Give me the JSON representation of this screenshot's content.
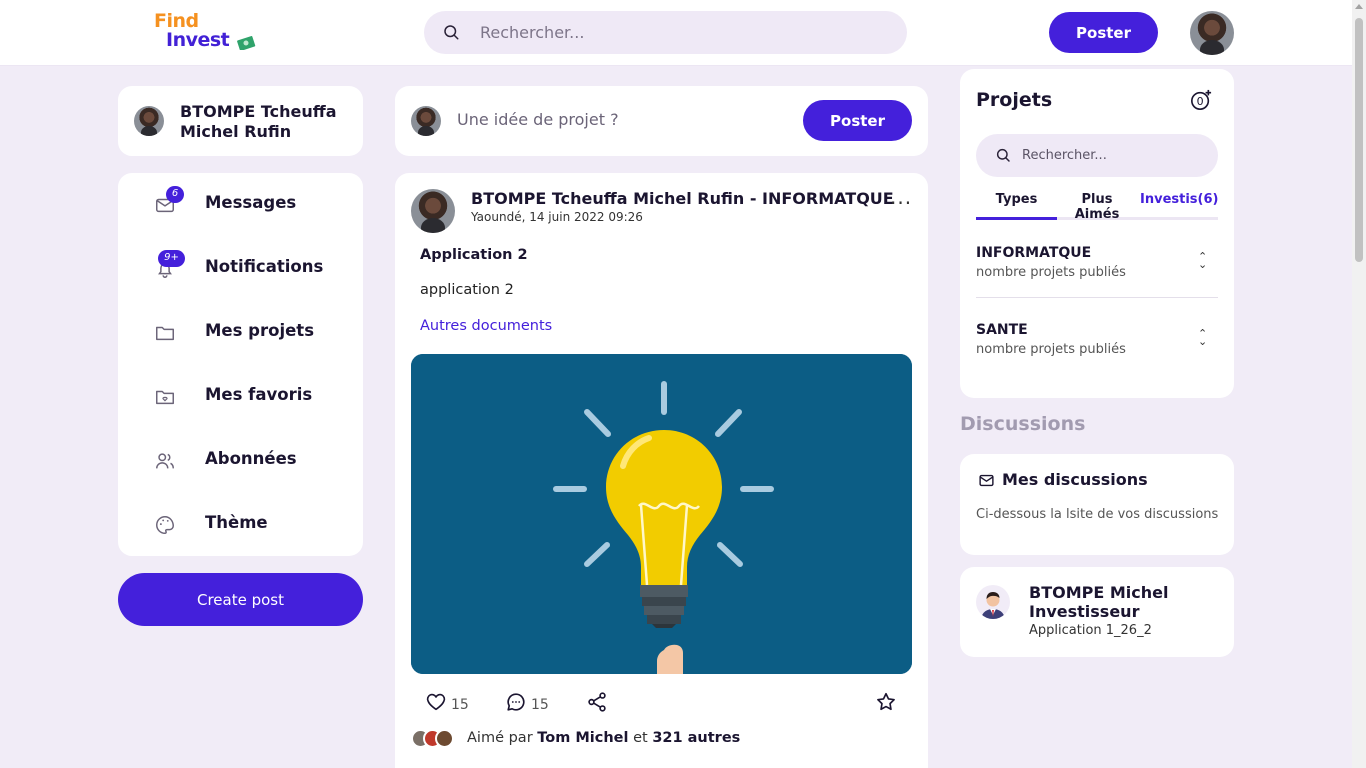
{
  "brand": {
    "logo_line1": "Find",
    "logo_line2": "Invest"
  },
  "topbar": {
    "search_placeholder": "Rechercher...",
    "post_label": "Poster"
  },
  "user": {
    "name": "BTOMPE Tcheuffa Michel Rufin"
  },
  "menu": {
    "items": [
      {
        "label": "Messages",
        "icon": "mail-icon",
        "badge": "6"
      },
      {
        "label": "Notifications",
        "icon": "bell-icon",
        "badge": "9+"
      },
      {
        "label": "Mes projets",
        "icon": "folder-icon"
      },
      {
        "label": "Mes favoris",
        "icon": "folder-heart-icon"
      },
      {
        "label": "Abonnées",
        "icon": "users-icon"
      },
      {
        "label": "Thème",
        "icon": "palette-icon"
      }
    ],
    "create_post": "Create post"
  },
  "composer": {
    "placeholder": "Une idée de projet ?",
    "post_label": "Poster"
  },
  "post": {
    "author": "BTOMPE Tcheuffa Michel Rufin - INFORMATQUE",
    "date": "Yaoundé, 14 juin 2022 09:26",
    "title": "Application 2",
    "body": "application 2",
    "link": "Autres documents",
    "likes": "15",
    "comments": "15",
    "liked_prefix": "Aimé par",
    "liked_name": "Tom Michel",
    "liked_and": "et",
    "liked_others": "321 autres"
  },
  "projets": {
    "title": "Projets",
    "search_placeholder": "Rechercher...",
    "tabs": [
      {
        "label": "Types",
        "active": true
      },
      {
        "label": "Plus Aimés",
        "active": false
      },
      {
        "label": "Investis(6)",
        "active": false
      }
    ],
    "categories": [
      {
        "name": "INFORMATQUE",
        "sub": "nombre projets publiés"
      },
      {
        "name": "SANTE",
        "sub": "nombre projets publiés"
      }
    ]
  },
  "discussions": {
    "heading": "Discussions",
    "title": "Mes discussions",
    "subtitle": "Ci-dessous la lsite de vos discussions",
    "contacts": [
      {
        "name": "BTOMPE Michel Investisseur",
        "message": "Application 1_26_2"
      }
    ]
  },
  "colors": {
    "accent": "#4420db",
    "brand_orange": "#f59120",
    "background": "#f1ecf7",
    "image_bg": "#0c5d85",
    "bulb": "#f2cc00"
  }
}
